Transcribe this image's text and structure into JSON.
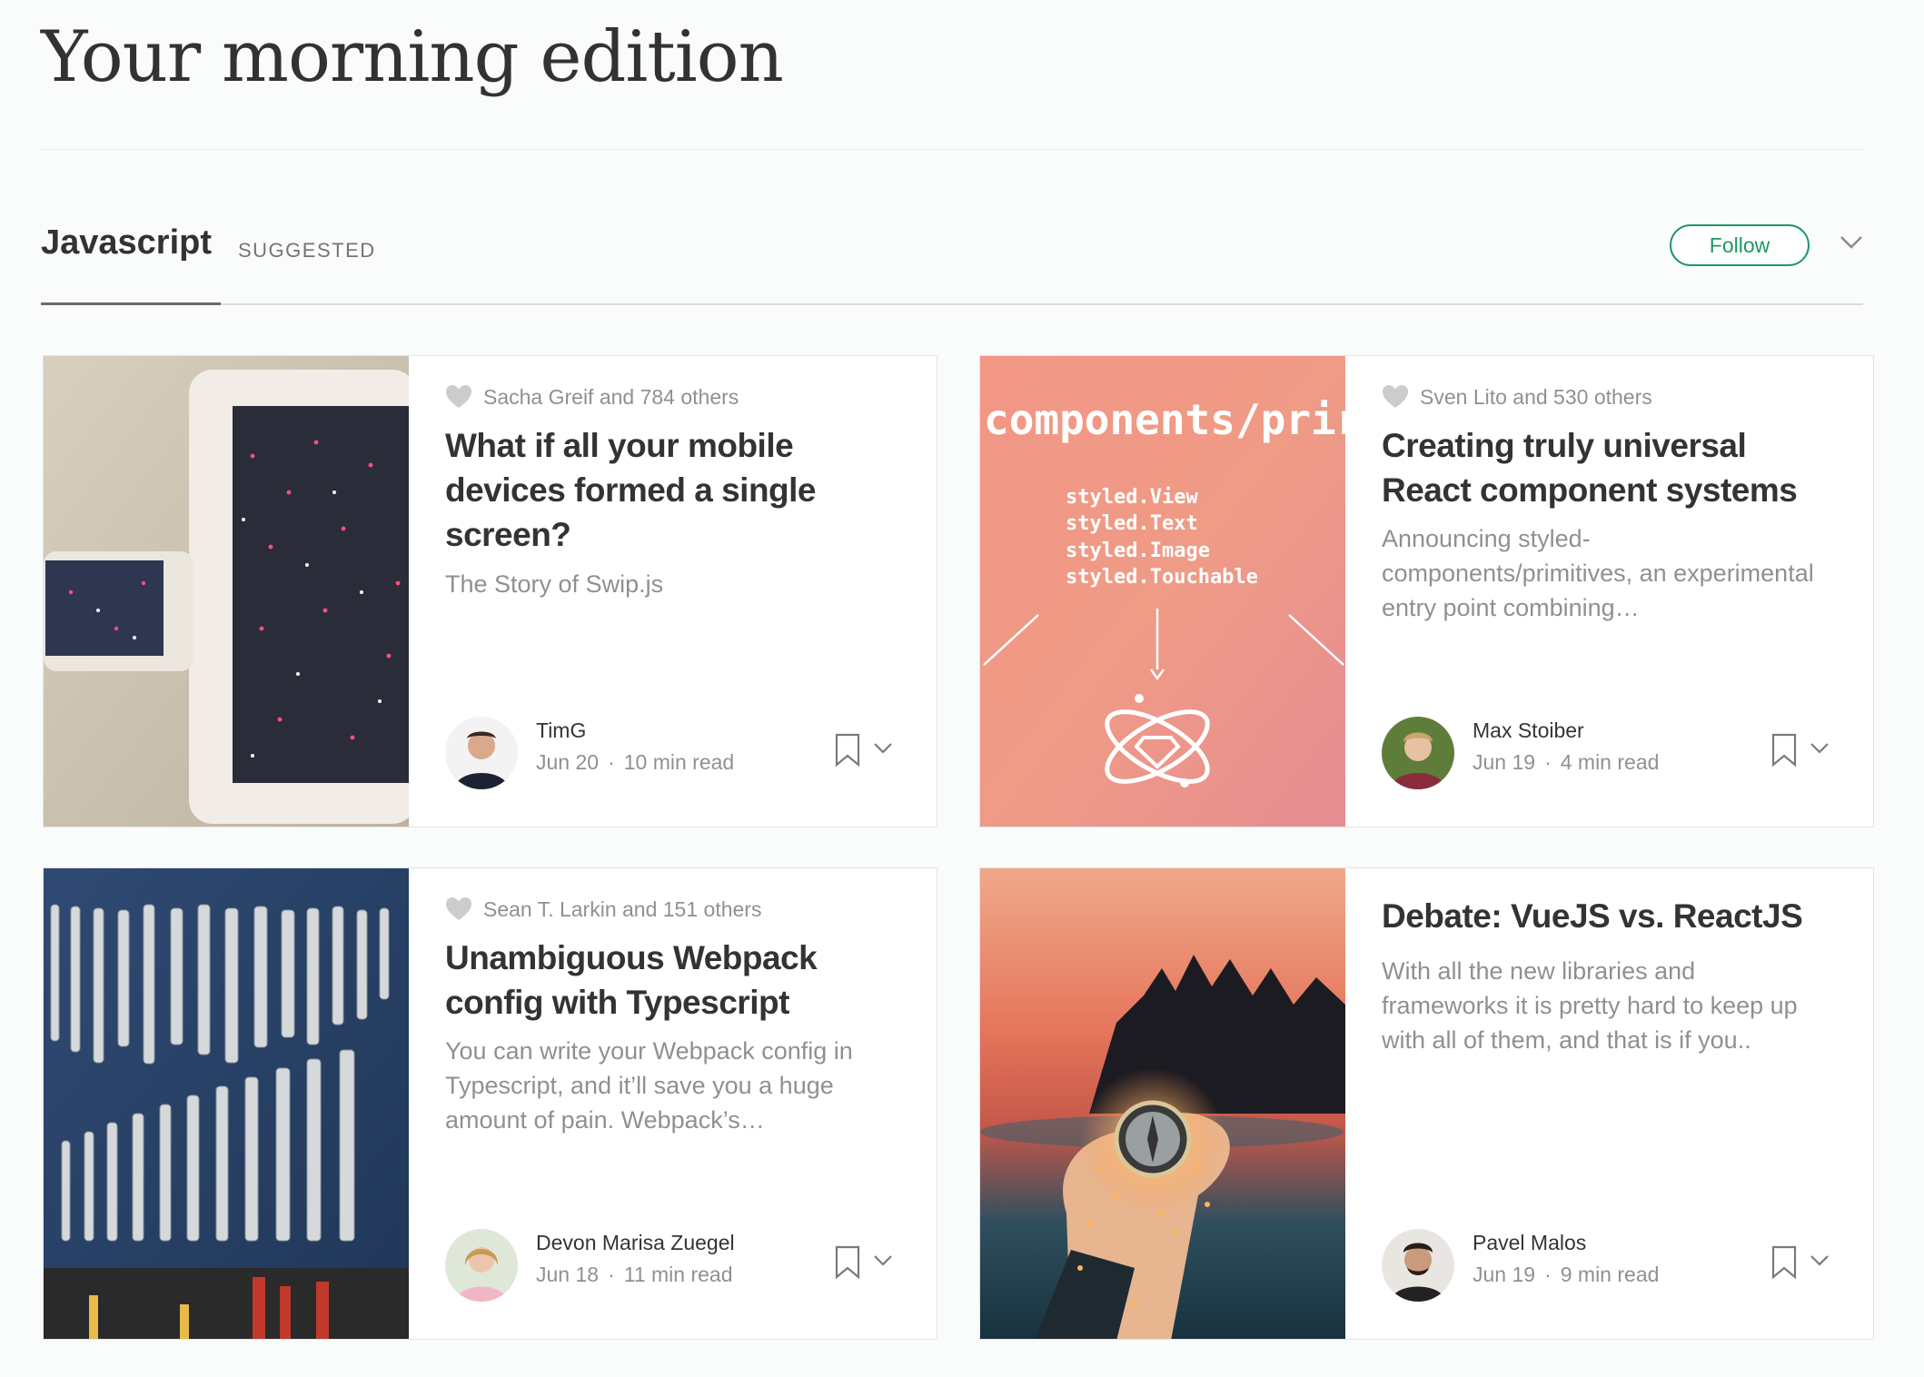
{
  "page": {
    "title": "Your morning edition"
  },
  "section": {
    "name": "Javascript",
    "tag": "SUGGESTED",
    "follow_label": "Follow"
  },
  "colors": {
    "accent": "#1c9963",
    "text_dark": "rgba(0,0,0,0.80)",
    "text_muted": "rgba(0,0,0,0.44)",
    "heart": "#cccccc"
  },
  "cards": [
    {
      "recommended_by": "Sacha Greif and 784 others",
      "title": "What if all your mobile devices formed a single screen?",
      "subtitle": "The Story of Swip.js",
      "author": "TimG",
      "date": "Jun 20",
      "read_time": "10 min read",
      "image": "tablet-and-phone-photo"
    },
    {
      "recommended_by": "Sven Lito and 530 others",
      "title": "Creating truly universal React component systems",
      "subtitle": "Announcing styled-components/primitives, an experimental entry point combining…",
      "author": "Max Stoiber",
      "date": "Jun 19",
      "read_time": "4 min read",
      "image": "styled-primitives-graphic",
      "image_text": {
        "headline": "components/prir",
        "code": [
          "styled.View",
          "styled.Text",
          "styled.Image",
          "styled.Touchable"
        ]
      }
    },
    {
      "recommended_by": "Sean T. Larkin and 151 others",
      "title": "Unambiguous Webpack config with Typescript",
      "subtitle": "You can write your Webpack config in Typescript, and it’ll save you a huge amount of pain. Webpack’s…",
      "author": "Devon Marisa Zuegel",
      "date": "Jun 18",
      "read_time": "11 min read",
      "image": "wrench-wall-photo"
    },
    {
      "recommended_by": "",
      "title": "Debate: VueJS vs. ReactJS",
      "subtitle": "With all the new libraries and frameworks it is pretty hard to keep up with all of them, and that is if you..",
      "author": "Pavel Malos",
      "date": "Jun 19",
      "read_time": "9 min read",
      "image": "compass-sunset-photo"
    }
  ]
}
